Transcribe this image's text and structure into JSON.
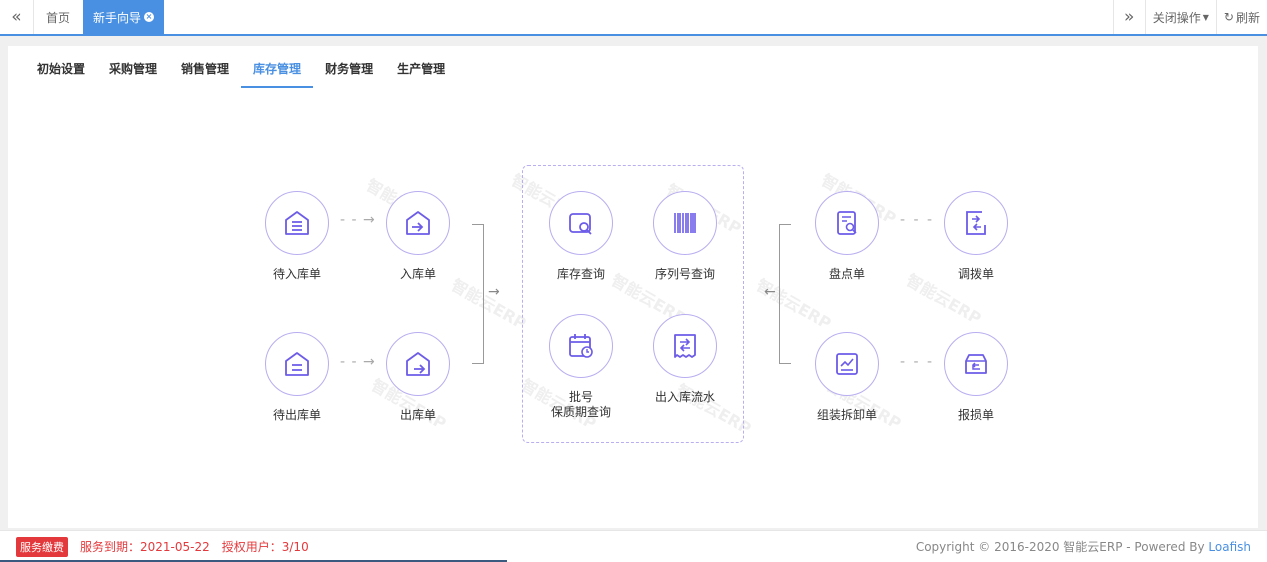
{
  "topbar": {
    "tabs": [
      {
        "label": "首页"
      },
      {
        "label": "新手向导"
      }
    ],
    "close_ops_label": "关闭操作",
    "refresh_label": "刷新"
  },
  "subtabs": [
    {
      "label": "初始设置"
    },
    {
      "label": "采购管理"
    },
    {
      "label": "销售管理"
    },
    {
      "label": "库存管理"
    },
    {
      "label": "财务管理"
    },
    {
      "label": "生产管理"
    }
  ],
  "flow": {
    "pending_in": "待入库单",
    "stock_in": "入库单",
    "pending_out": "待出库单",
    "stock_out": "出库单",
    "stock_query": "库存查询",
    "serial_query": "序列号查询",
    "batch_line1": "批号",
    "batch_line2": "保质期查询",
    "flow_record": "出入库流水",
    "inventory_check": "盘点单",
    "transfer": "调拨单",
    "assembly": "组装拆卸单",
    "damage": "报损单"
  },
  "watermark": "智能云ERP",
  "footer": {
    "badge": "服务缴费",
    "service_label": "服务到期：2021-05-22",
    "users_label": "授权用户：3/10",
    "copyright_prefix": "Copyright © 2016-2020 智能云ERP - Powered By ",
    "copyright_brand": "Loafish"
  },
  "colors": {
    "accent": "#4a90e2",
    "circle_border": "#b8aef0",
    "icon": "#6c5ce7",
    "danger": "#e4393c"
  }
}
